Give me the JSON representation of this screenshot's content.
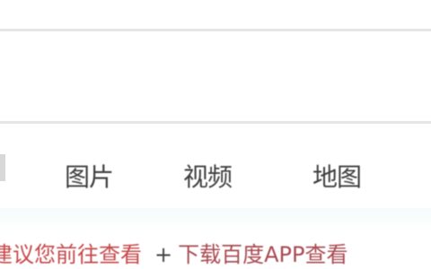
{
  "tabs": [
    {
      "label": "图片"
    },
    {
      "label": "视频"
    },
    {
      "label": "地图"
    }
  ],
  "footer_links": {
    "left": "建议您前往查看",
    "right_prefix": "+",
    "right": "下载百度APP查看"
  }
}
